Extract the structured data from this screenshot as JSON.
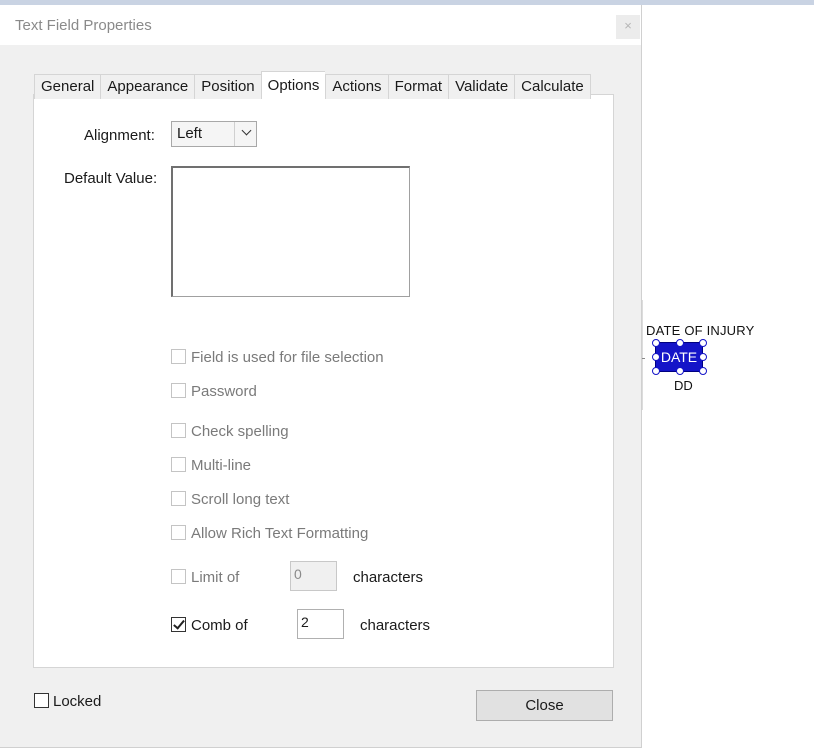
{
  "dialog": {
    "title": "Text Field Properties",
    "close_glyph": "×"
  },
  "tabs": [
    {
      "label": "General",
      "active": false
    },
    {
      "label": "Appearance",
      "active": false
    },
    {
      "label": "Position",
      "active": false
    },
    {
      "label": "Options",
      "active": true
    },
    {
      "label": "Actions",
      "active": false
    },
    {
      "label": "Format",
      "active": false
    },
    {
      "label": "Validate",
      "active": false
    },
    {
      "label": "Calculate",
      "active": false
    }
  ],
  "options": {
    "alignment_label": "Alignment:",
    "alignment_value": "Left",
    "default_value_label": "Default Value:",
    "default_value": "",
    "checkboxes": {
      "file_selection": {
        "label": "Field is used for file selection",
        "checked": false,
        "enabled": false
      },
      "password": {
        "label": "Password",
        "checked": false,
        "enabled": false
      },
      "check_spelling": {
        "label": "Check spelling",
        "checked": false,
        "enabled": false
      },
      "multi_line": {
        "label": "Multi-line",
        "checked": false,
        "enabled": false
      },
      "scroll_long_text": {
        "label": "Scroll long text",
        "checked": false,
        "enabled": false
      },
      "rich_text": {
        "label": "Allow Rich Text Formatting",
        "checked": false,
        "enabled": false
      }
    },
    "limit": {
      "label": "Limit of",
      "value": "0",
      "suffix": "characters",
      "checked": false,
      "enabled": false
    },
    "comb": {
      "label": "Comb of",
      "value": "2",
      "suffix": "characters",
      "checked": true,
      "enabled": true
    }
  },
  "footer": {
    "locked_label": "Locked",
    "locked_checked": false,
    "close_label": "Close"
  },
  "page": {
    "label_top": "DATE OF INJURY",
    "field_text": "DATE",
    "label_bottom": "DD",
    "field_color": "#1414c8"
  }
}
